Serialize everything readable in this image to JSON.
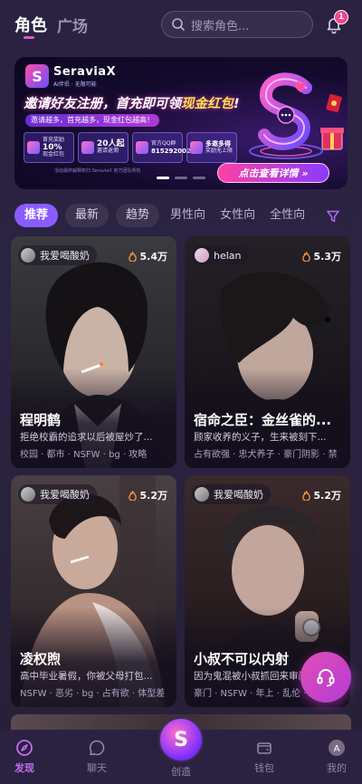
{
  "header": {
    "tab_role": "角色",
    "tab_square": "广场",
    "search_placeholder": "搜索角色...",
    "notification_count": "1"
  },
  "banner": {
    "brand_name": "SeraviaX",
    "brand_sub": "AI伴侣 · 无限可能",
    "headline_a": "邀请好友注册，首充即可领",
    "headline_b": "现金红包",
    "headline_c": "!",
    "sub": "邀请越多，首充越多，现金红包越高！",
    "cards": [
      {
        "line1": "首充奖励",
        "big": "10%",
        "line2": "现金红包"
      },
      {
        "line1": "",
        "big": "20人起",
        "line2": "邀请返佣"
      },
      {
        "line1": "官方QQ群",
        "big": "815292002",
        "line2": ""
      },
      {
        "line1": "",
        "big": "多邀多得",
        "line2": "奖励无上限"
      }
    ],
    "footer": "活动最终解释权归 SeraviaX 官方团队所有",
    "cta": "点击查看详情 »",
    "colors": {
      "accent": "#ff3fa4",
      "gold": "#ffe14a"
    }
  },
  "filters": [
    "推荐",
    "最新",
    "趋势",
    "男性向",
    "女性向",
    "全性向"
  ],
  "active_filter": 0,
  "cards": [
    {
      "author": "我爱喝酸奶",
      "heat": "5.4万",
      "title": "程明鹤",
      "desc": "拒绝校霸的追求以后被屋炒了...",
      "tags": "校园 · 都市 · NSFW · bg · 攻略"
    },
    {
      "author": "helan",
      "heat": "5.3万",
      "title": "宿命之臣：金丝雀的...",
      "desc": "顾家收养的义子，生来被刻下...",
      "tags": "占有欲强 · 忠犬养子 · 豪门阴影 · 禁"
    },
    {
      "author": "我爱喝酸奶",
      "heat": "5.2万",
      "title": "凌权煦",
      "desc": "高中毕业暑假，你被父母打包...",
      "tags": "NSFW · 恶劣 · bg · 占有欲 · 体型差"
    },
    {
      "author": "我爱喝酸奶",
      "heat": "5.2万",
      "title": "小叔不可以内射",
      "desc": "因为鬼混被小叔抓回来审问...",
      "tags": "豪门 · NSFW · 年上 · 乱伦 · 叔侄"
    }
  ],
  "nav": {
    "discover": "发现",
    "chat": "聊天",
    "create": "创造",
    "wallet": "钱包",
    "mine": "我的"
  }
}
